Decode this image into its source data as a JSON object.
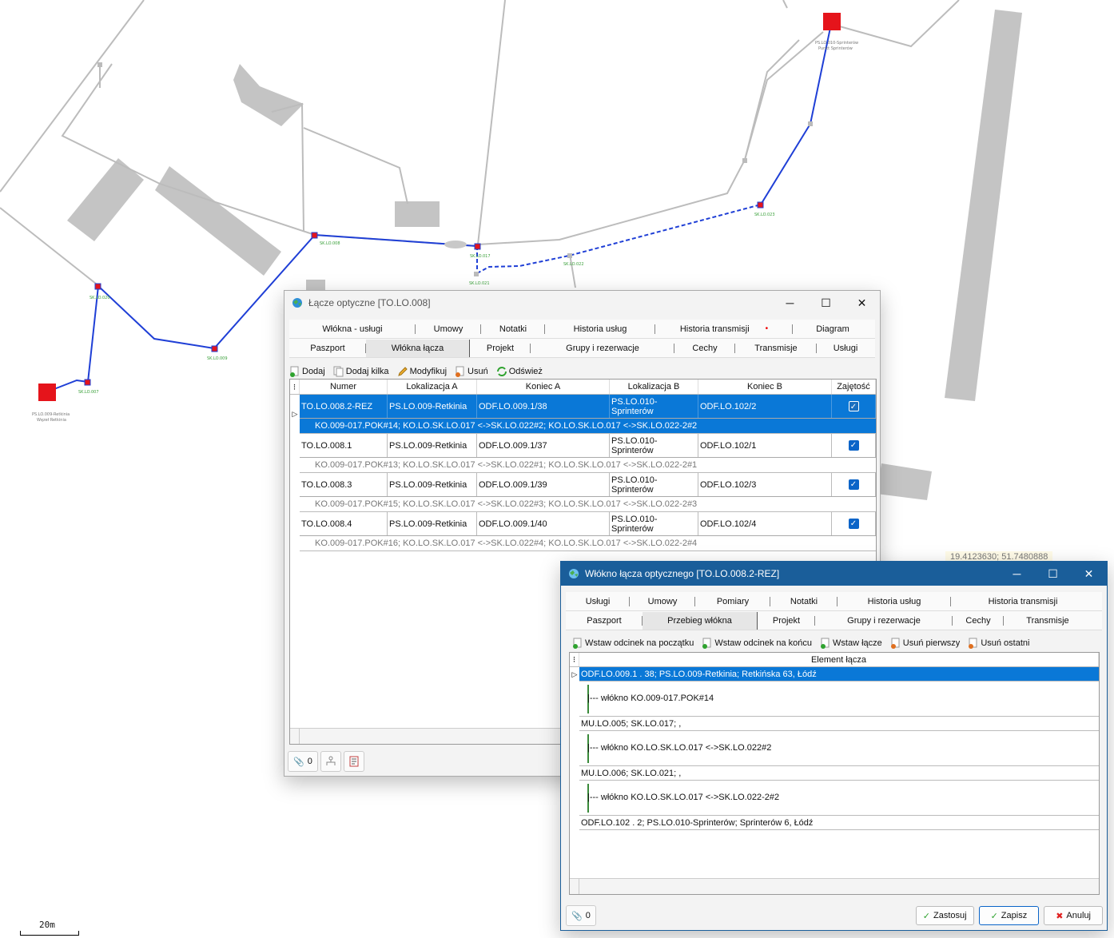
{
  "map": {
    "labels": {
      "ps_009": "PS.LO.009-Retkinia",
      "ps_009_sub": "Węzeł Retkinia",
      "ps_010": "PS.LO.010-Sprinterów",
      "ps_010_sub": "Punkt Sprinterów",
      "sk_007": "SK.LO.007",
      "sk_008": "SK.LO.008",
      "sk_009": "SK.LO.009",
      "sk_017": "SK.LO.017",
      "sk_020": "SK.LO.020",
      "sk_021": "SK.LO.021",
      "sk_022": "SK.LO.022",
      "sk_023": "SK.LO.023"
    },
    "coords": "19.4123630; 51.7480888",
    "scale": "20m",
    "colors": {
      "route": "#1f3fd6",
      "node": "#e5141b",
      "building": "#c2c2c2",
      "duct": "#bdbdbd"
    }
  },
  "win1": {
    "title": "Łącze optyczne [TO.LO.008]",
    "tabs_row1": [
      "Włókna - usługi",
      "Umowy",
      "Notatki",
      "Historia usług",
      "Historia transmisji",
      "Diagram"
    ],
    "tabs_row2": [
      "Paszport",
      "Włókna łącza",
      "Projekt",
      "Grupy i rezerwacje",
      "Cechy",
      "Transmisje",
      "Usługi"
    ],
    "toolbar": [
      "Dodaj",
      "Dodaj kilka",
      "Modyfikuj",
      "Usuń",
      "Odśwież"
    ],
    "columns": [
      "Numer",
      "Lokalizacja A",
      "Koniec A",
      "Lokalizacja B",
      "Koniec B",
      "Zajętość"
    ],
    "rows": [
      {
        "numer": "TO.LO.008.2-REZ",
        "lokA": "PS.LO.009-Retkinia",
        "konA": "ODF.LO.009.1/38",
        "lokB": "PS.LO.010-Sprinterów",
        "konB": "ODF.LO.102/2",
        "sub": "KO.009-017.POK#14; KO.LO.SK.LO.017 <->SK.LO.022#2; KO.LO.SK.LO.017 <->SK.LO.022-2#2"
      },
      {
        "numer": "TO.LO.008.1",
        "lokA": "PS.LO.009-Retkinia",
        "konA": "ODF.LO.009.1/37",
        "lokB": "PS.LO.010-Sprinterów",
        "konB": "ODF.LO.102/1",
        "sub": "KO.009-017.POK#13; KO.LO.SK.LO.017 <->SK.LO.022#1; KO.LO.SK.LO.017 <->SK.LO.022-2#1"
      },
      {
        "numer": "TO.LO.008.3",
        "lokA": "PS.LO.009-Retkinia",
        "konA": "ODF.LO.009.1/39",
        "lokB": "PS.LO.010-Sprinterów",
        "konB": "ODF.LO.102/3",
        "sub": "KO.009-017.POK#15; KO.LO.SK.LO.017 <->SK.LO.022#3; KO.LO.SK.LO.017 <->SK.LO.022-2#3"
      },
      {
        "numer": "TO.LO.008.4",
        "lokA": "PS.LO.009-Retkinia",
        "konA": "ODF.LO.009.1/40",
        "lokB": "PS.LO.010-Sprinterów",
        "konB": "ODF.LO.102/4",
        "sub": "KO.009-017.POK#16; KO.LO.SK.LO.017 <->SK.LO.022#4; KO.LO.SK.LO.017 <->SK.LO.022-2#4"
      }
    ],
    "attach_count": "0"
  },
  "win2": {
    "title": "Włókno łącza optycznego [TO.LO.008.2-REZ]",
    "tabs_row1": [
      "Usługi",
      "Umowy",
      "Pomiary",
      "Notatki",
      "Historia usług",
      "Historia transmisji"
    ],
    "tabs_row2": [
      "Paszport",
      "Przebieg włókna",
      "Projekt",
      "Grupy i rezerwacje",
      "Cechy",
      "Transmisje"
    ],
    "toolbar": [
      "Wstaw odcinek na początku",
      "Wstaw odcinek na końcu",
      "Wstaw łącze",
      "Usuń pierwszy",
      "Usuń ostatni"
    ],
    "column": "Element łącza",
    "elements": [
      {
        "type": "node",
        "text": "ODF.LO.009.1 . 38; PS.LO.009-Retkinia; Retkińska 63, Łódź"
      },
      {
        "type": "fiber",
        "text": "|--- włókno KO.009-017.POK#14"
      },
      {
        "type": "node",
        "text": "MU.LO.005; SK.LO.017; ,"
      },
      {
        "type": "fiber",
        "text": "|--- włókno KO.LO.SK.LO.017 <->SK.LO.022#2"
      },
      {
        "type": "node",
        "text": "MU.LO.006; SK.LO.021; ,"
      },
      {
        "type": "fiber",
        "text": "|--- włókno KO.LO.SK.LO.017 <->SK.LO.022-2#2"
      },
      {
        "type": "node",
        "text": "ODF.LO.102 . 2; PS.LO.010-Sprinterów; Sprinterów 6, Łódź"
      }
    ],
    "attach_count": "0",
    "buttons": {
      "apply": "Zastosuj",
      "save": "Zapisz",
      "cancel": "Anuluj"
    }
  }
}
